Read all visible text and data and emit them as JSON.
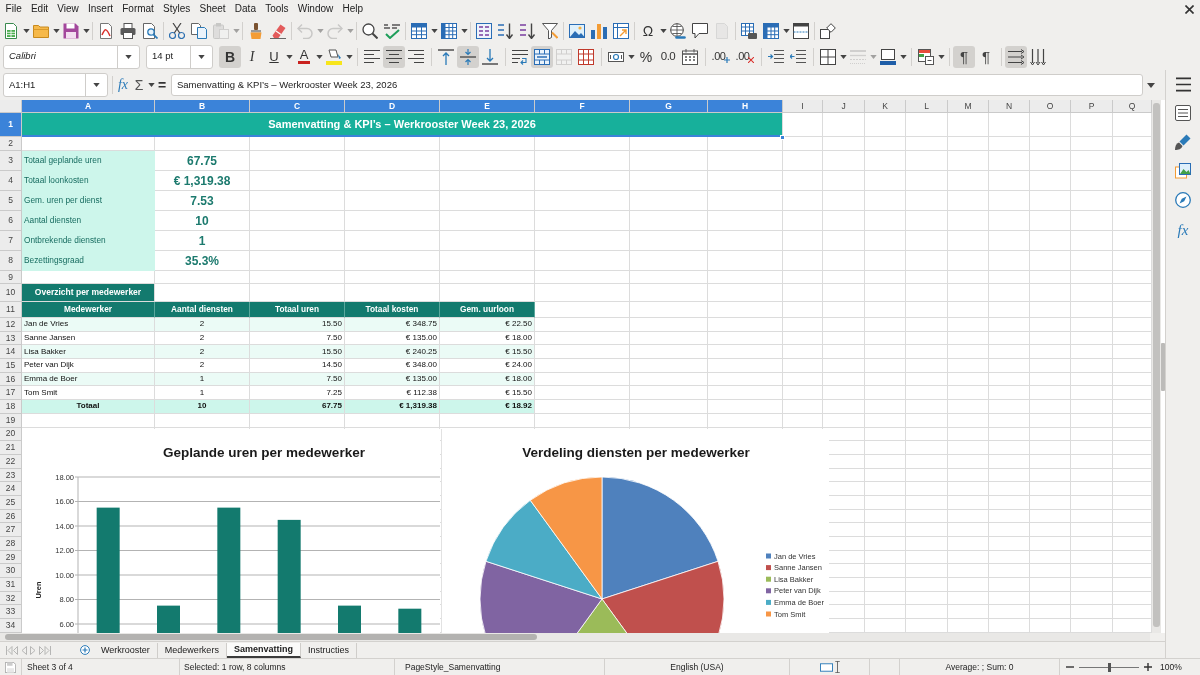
{
  "menu": [
    "File",
    "Edit",
    "View",
    "Insert",
    "Format",
    "Styles",
    "Sheet",
    "Data",
    "Tools",
    "Window",
    "Help"
  ],
  "standard_toolbar": {
    "special_character_glyph": "Ω"
  },
  "formatting_toolbar": {
    "font_name": "Calibri",
    "font_size": "14 pt",
    "text_styles": [
      {
        "glyph": "B",
        "pressed": true
      },
      {
        "glyph": "I",
        "pressed": false
      },
      {
        "glyph": "U",
        "pressed": false
      }
    ],
    "font_color_glyph": "A",
    "align_left": false,
    "align_center": true,
    "align_right": false,
    "align_top": false,
    "align_middle": true,
    "align_bottom": false,
    "wrap_text": false,
    "merge_and_center": true,
    "percent_glyph": "%",
    "number_glyph": "0.0",
    "decimal_glyphs": [
      ".00",
      ".00"
    ],
    "paragraph_direction": [
      {
        "glyph": "¶",
        "pressed": true
      },
      {
        "glyph": "¶",
        "pressed": false
      }
    ],
    "text_direction": [
      {
        "pressed": true
      },
      {
        "pressed": false
      }
    ]
  },
  "formula_bar": {
    "name_box": "A1:H1",
    "wizard_glyph": "fx",
    "sum_glyph": "Σ",
    "equals_glyph": "=",
    "content": "Samenvatting & KPI’s – Werkrooster Week 23, 2026"
  },
  "sidebar": {
    "functions_glyph": "fx"
  },
  "sheet": {
    "columns": [
      {
        "label": "A",
        "selected": true
      },
      {
        "label": "B",
        "selected": true
      },
      {
        "label": "C",
        "selected": true
      },
      {
        "label": "D",
        "selected": true
      },
      {
        "label": "E",
        "selected": true
      },
      {
        "label": "F",
        "selected": true
      },
      {
        "label": "G",
        "selected": true
      },
      {
        "label": "H",
        "selected": true
      },
      {
        "label": "I",
        "selected": false
      },
      {
        "label": "J",
        "selected": false
      },
      {
        "label": "K",
        "selected": false
      },
      {
        "label": "L",
        "selected": false
      },
      {
        "label": "M",
        "selected": false
      },
      {
        "label": "N",
        "selected": false
      },
      {
        "label": "O",
        "selected": false
      },
      {
        "label": "P",
        "selected": false
      },
      {
        "label": "Q",
        "selected": false
      }
    ],
    "rows": [
      {
        "label": "1",
        "selected": true
      },
      {
        "label": "2",
        "selected": false
      },
      {
        "label": "3",
        "selected": false
      },
      {
        "label": "4",
        "selected": false
      },
      {
        "label": "5",
        "selected": false
      },
      {
        "label": "6",
        "selected": false
      },
      {
        "label": "7",
        "selected": false
      },
      {
        "label": "8",
        "selected": false
      },
      {
        "label": "9",
        "selected": false
      },
      {
        "label": "10",
        "selected": false
      },
      {
        "label": "11",
        "selected": false
      },
      {
        "label": "12",
        "selected": false
      },
      {
        "label": "13",
        "selected": false
      },
      {
        "label": "14",
        "selected": false
      },
      {
        "label": "15",
        "selected": false
      },
      {
        "label": "16",
        "selected": false
      },
      {
        "label": "17",
        "selected": false
      },
      {
        "label": "18",
        "selected": false
      },
      {
        "label": "19",
        "selected": false
      },
      {
        "label": "20",
        "selected": false
      },
      {
        "label": "21",
        "selected": false
      },
      {
        "label": "22",
        "selected": false
      },
      {
        "label": "23",
        "selected": false
      },
      {
        "label": "24",
        "selected": false
      },
      {
        "label": "25",
        "selected": false
      },
      {
        "label": "26",
        "selected": false
      },
      {
        "label": "27",
        "selected": false
      },
      {
        "label": "28",
        "selected": false
      },
      {
        "label": "29",
        "selected": false
      },
      {
        "label": "30",
        "selected": false
      },
      {
        "label": "31",
        "selected": false
      },
      {
        "label": "32",
        "selected": false
      },
      {
        "label": "33",
        "selected": false
      },
      {
        "label": "34",
        "selected": false
      }
    ],
    "title": "Samenvatting & KPI’s – Werkrooster Week 23, 2026",
    "kpis": [
      {
        "label": "Totaal geplande uren",
        "value": "67.75"
      },
      {
        "label": "Totaal loonkosten",
        "value": "€ 1,319.38"
      },
      {
        "label": "Gem. uren per dienst",
        "value": "7.53"
      },
      {
        "label": "Aantal diensten",
        "value": "10"
      },
      {
        "label": "Ontbrekende diensten",
        "value": "1"
      },
      {
        "label": "Bezettingsgraad",
        "value": "35.3%"
      }
    ],
    "overview": {
      "title": "Overzicht per medewerker",
      "columns": [
        "Medewerker",
        "Aantal diensten",
        "Totaal uren",
        "Totaal kosten",
        "Gem. uurloon"
      ],
      "rows": [
        [
          "Jan de Vries",
          "2",
          "15.50",
          "€ 348.75",
          "€ 22.50"
        ],
        [
          "Sanne Jansen",
          "2",
          "7.50",
          "€ 135.00",
          "€ 18.00"
        ],
        [
          "Lisa Bakker",
          "2",
          "15.50",
          "€ 240.25",
          "€ 15.50"
        ],
        [
          "Peter van Dijk",
          "2",
          "14.50",
          "€ 348.00",
          "€ 24.00"
        ],
        [
          "Emma de Boer",
          "1",
          "7.50",
          "€ 135.00",
          "€ 18.00"
        ],
        [
          "Tom Smit",
          "1",
          "7.25",
          "€ 112.38",
          "€ 15.50"
        ]
      ],
      "total": [
        "Totaal",
        "10",
        "67.75",
        "€ 1,319.38",
        "€ 18.92"
      ]
    },
    "bar_chart": {
      "chart_data": {
        "type": "bar",
        "title": "Geplande uren per medewerker",
        "ylabel": "Uren",
        "series": [
          {
            "color": "#137a6e",
            "values": [
              15.5,
              7.5,
              15.5,
              14.5,
              7.5,
              7.25
            ]
          }
        ],
        "ylim": [
          0,
          18
        ],
        "yticks": [
          {
            "value": 6,
            "label": "6.00"
          },
          {
            "value": 8,
            "label": "8.00"
          },
          {
            "value": 10,
            "label": "10.00"
          },
          {
            "value": 12,
            "label": "12.00"
          },
          {
            "value": 14,
            "label": "14.00"
          },
          {
            "value": 16,
            "label": "16.00"
          },
          {
            "value": 18,
            "label": "18.00"
          }
        ],
        "grid": true
      }
    },
    "pie_chart": {
      "chart_data": {
        "type": "pie",
        "title": "Verdeling diensten per medewerker",
        "categories": [
          "Jan de Vries",
          "Sanne Jansen",
          "Lisa Bakker",
          "Peter van Dijk",
          "Emma de Boer",
          "Tom Smit"
        ],
        "values": [
          20,
          20,
          20,
          20,
          10,
          10
        ],
        "colors": [
          "#4f81bd",
          "#c0504d",
          "#9bbb59",
          "#8064a2",
          "#4bacc6",
          "#f79646"
        ],
        "legend": "right"
      }
    }
  },
  "sheet_tabs": [
    {
      "label": "Werkrooster",
      "selected": false
    },
    {
      "label": "Medewerkers",
      "selected": false
    },
    {
      "label": "Samenvatting",
      "selected": true
    },
    {
      "label": "Instructies",
      "selected": false
    }
  ],
  "status_bar": {
    "sheet": "Sheet 3 of 4",
    "selection": "Selected: 1 row, 8 columns",
    "page_style": "PageStyle_Samenvatting",
    "language": "English (USA)",
    "summary": "Average: ; Sum: 0",
    "zoom": {
      "level": 0.5,
      "percent": "100%"
    }
  }
}
